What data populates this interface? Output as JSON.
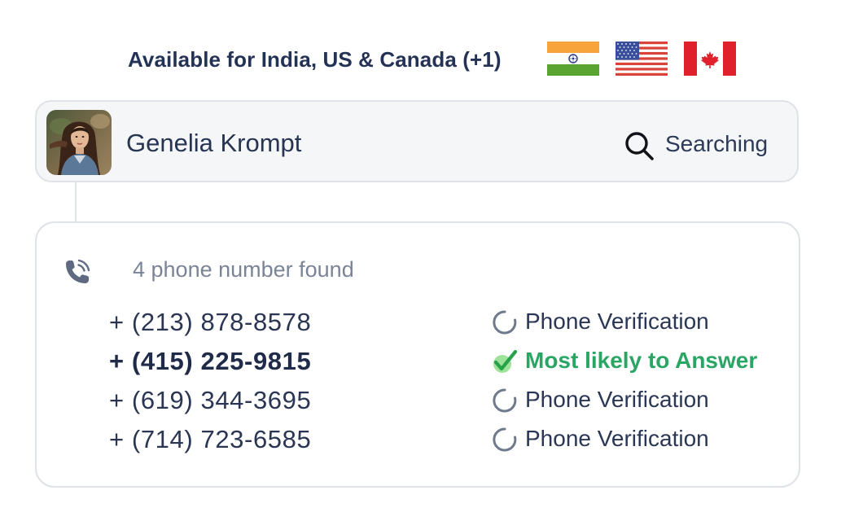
{
  "availability": {
    "text": "Available for India, US & Canada (+1)",
    "flags": [
      "india-flag",
      "us-flag",
      "canada-flag"
    ]
  },
  "person": {
    "name": "Genelia Krompt",
    "search_status": "Searching"
  },
  "results": {
    "found_label": "4 phone number found",
    "numbers": [
      {
        "number": "+ (213) 878-8578",
        "status": "Phone Verification",
        "icon": "spinner-icon",
        "highlight": false
      },
      {
        "number": "+ (415) 225-9815",
        "status": "Most likely to Answer",
        "icon": "checkmark-icon",
        "highlight": true
      },
      {
        "number": "+ (619) 344-3695",
        "status": "Phone Verification",
        "icon": "spinner-icon",
        "highlight": false
      },
      {
        "number": "+ (714) 723-6585",
        "status": "Phone Verification",
        "icon": "spinner-icon",
        "highlight": false
      }
    ]
  },
  "colors": {
    "text_dark": "#243355",
    "text_muted": "#7a8496",
    "success_green": "#2aa564",
    "card_bg": "#f5f6f8",
    "border": "#dfe2e7"
  }
}
